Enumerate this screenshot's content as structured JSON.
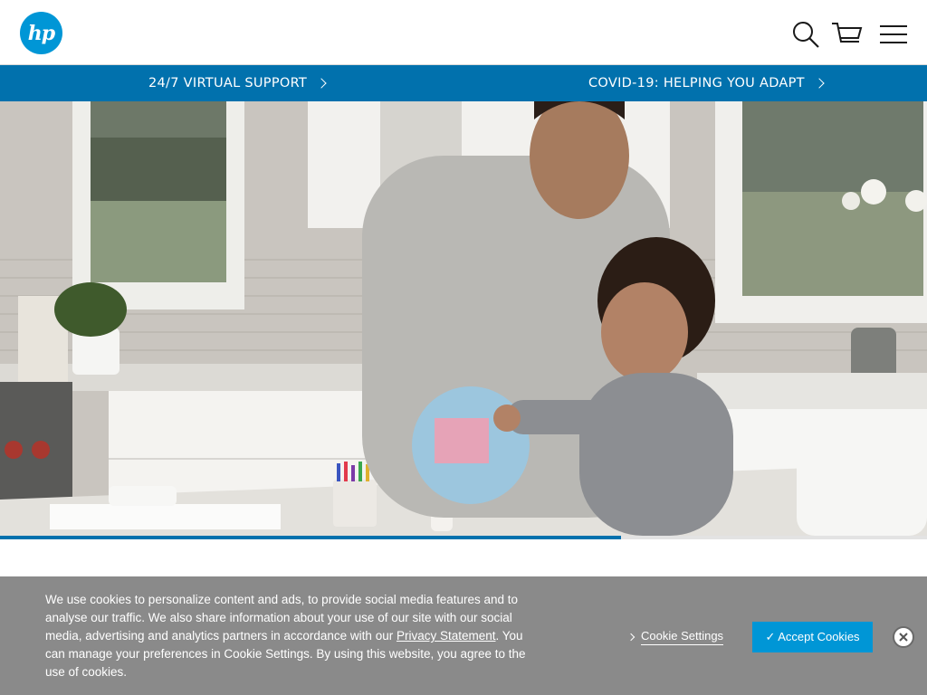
{
  "header": {
    "logo_text": "hp",
    "icons": [
      "search-icon",
      "cart-icon",
      "hamburger-menu-icon"
    ]
  },
  "promo": {
    "support_label": "24/7 VIRTUAL SUPPORT",
    "covid_label": "COVID-19: HELPING YOU ADAPT"
  },
  "hero": {
    "image_description": "Father and son decorating a globe at a kitchen counter",
    "progress": 0.67
  },
  "cookie": {
    "text_part1": "We use cookies to personalize content and ads, to provide social media features and to analyse our traffic. We also share information about your use of our site with our social media, advertising and analytics partners in accordance with our ",
    "privacy_link": "Privacy Statement",
    "text_part2": ". You can manage your preferences in Cookie Settings. By using this website, you agree to the use of cookies.",
    "settings_label": "Cookie Settings",
    "accept_label": "✓ Accept Cookies"
  },
  "colors": {
    "brand_blue": "#0096d6",
    "banner_blue": "#0171ad",
    "cookie_gray": "#8a8a8a"
  }
}
